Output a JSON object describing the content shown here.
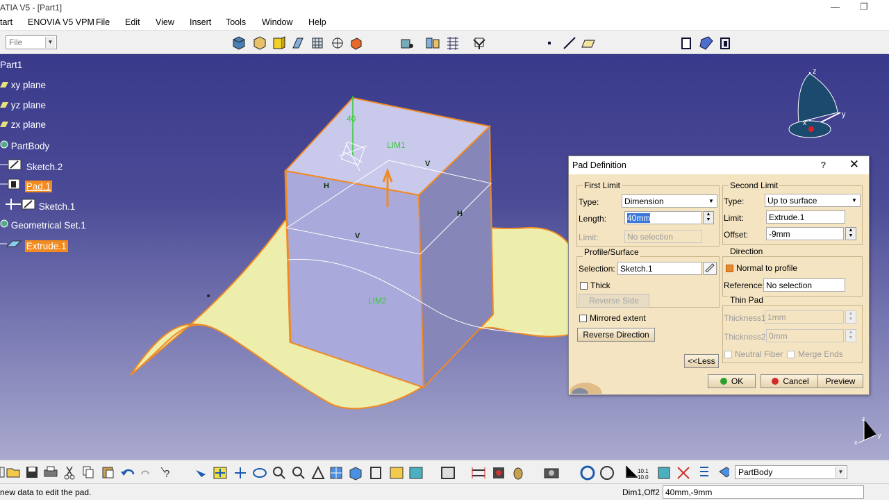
{
  "window": {
    "title": "ATIA V5 - [Part1]",
    "minimize_glyph": "—",
    "restore_glyph": "❐"
  },
  "menu": {
    "start": "tart",
    "enovia": "ENOVIA V5 VPM",
    "file": "File",
    "edit": "Edit",
    "view": "View",
    "insert": "Insert",
    "tools": "Tools",
    "window": "Window",
    "help": "Help"
  },
  "toolbar_top": {
    "file_combo": "File"
  },
  "tree": {
    "root": "Part1",
    "xy": "xy plane",
    "yz": "yz plane",
    "zx": "zx plane",
    "partbody": "PartBody",
    "sketch2": "Sketch.2",
    "pad1": "Pad.1",
    "sketch1": "Sketch.1",
    "geoset": "Geometrical Set.1",
    "extrude1": "Extrude.1"
  },
  "viewport_labels": {
    "dim": "40",
    "lim1": "LIM1",
    "lim2": "LIM2",
    "h": "H",
    "v": "V"
  },
  "compass": {
    "z": "z",
    "y": "y",
    "x": "x"
  },
  "colors": {
    "selection": "#f28a1e",
    "geometry_edge": "#f08a24",
    "surface": "#eeeeac",
    "annotation_green": "#33cc33"
  },
  "dialog": {
    "title": "Pad Definition",
    "help": "?",
    "close": "✕",
    "first_limit": {
      "title": "First Limit",
      "type_label": "Type:",
      "type_value": "Dimension",
      "length_label": "Length:",
      "length_value": "40mm",
      "limit_label": "Limit:",
      "limit_value": "No selection"
    },
    "second_limit": {
      "title": "Second Limit",
      "type_label": "Type:",
      "type_value": "Up to surface",
      "limit_label": "Limit:",
      "limit_value": "Extrude.1",
      "offset_label": "Offset:",
      "offset_value": "-9mm"
    },
    "profile": {
      "title": "Profile/Surface",
      "selection_label": "Selection:",
      "selection_value": "Sketch.1",
      "thick": "Thick",
      "reverse_side": "Reverse Side"
    },
    "direction": {
      "title": "Direction",
      "normal": "Normal to profile",
      "reference_label": "Reference:",
      "reference_value": "No selection"
    },
    "thin_pad": {
      "title": "Thin Pad",
      "t1_label": "Thickness1:",
      "t1_value": "1mm",
      "t2_label": "Thickness2:",
      "t2_value": "0mm",
      "neutral": "Neutral Fiber",
      "merge": "Merge Ends"
    },
    "mirrored": "Mirrored extent",
    "reverse_direction": "Reverse Direction",
    "less": "<<Less",
    "ok": "OK",
    "cancel": "Cancel",
    "preview": "Preview"
  },
  "toolbar_bottom": {
    "body_combo": "PartBody"
  },
  "status": {
    "message": "new data to edit the pad.",
    "prompt": "Dim1,Off2",
    "input": "40mm,-9mm"
  }
}
